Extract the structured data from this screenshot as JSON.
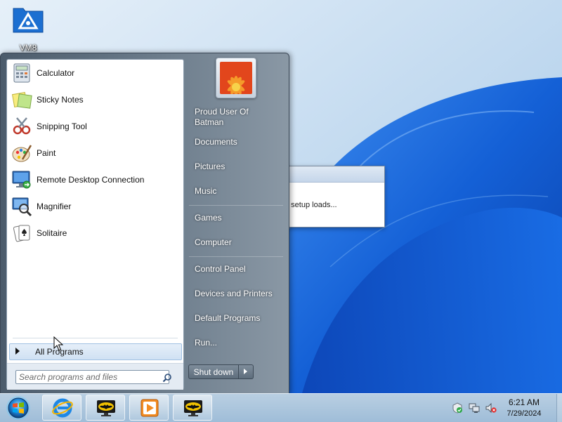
{
  "desktop": {
    "icons": [
      {
        "label": "VM8",
        "icon": "vm8-logo-icon"
      }
    ]
  },
  "dialog": {
    "message": "e setup loads..."
  },
  "start_menu": {
    "pinned": [
      {
        "label": "Calculator",
        "icon": "calculator-icon"
      },
      {
        "label": "Sticky Notes",
        "icon": "sticky-notes-icon"
      },
      {
        "label": "Snipping Tool",
        "icon": "snipping-tool-icon"
      },
      {
        "label": "Paint",
        "icon": "paint-icon"
      },
      {
        "label": "Remote Desktop Connection",
        "icon": "remote-desktop-icon"
      },
      {
        "label": "Magnifier",
        "icon": "magnifier-icon"
      },
      {
        "label": "Solitaire",
        "icon": "solitaire-icon"
      }
    ],
    "all_programs_label": "All Programs",
    "search_placeholder": "Search programs and files",
    "user_name": "Proud User Of Batman",
    "right_items": [
      "Documents",
      "Pictures",
      "Music",
      "Games",
      "Computer",
      "Control Panel",
      "Devices and Printers",
      "Default Programs",
      "Run..."
    ],
    "shutdown_label": "Shut down"
  },
  "taskbar": {
    "buttons": [
      "internet-explorer-icon",
      "batman-app-icon",
      "media-player-icon",
      "batman-app-icon"
    ],
    "tray_icons": [
      "action-center-icon",
      "network-icon",
      "volume-muted-icon"
    ],
    "clock": {
      "time": "6:21 AM",
      "date": "7/29/2024"
    }
  },
  "colors": {
    "wallpaper_blue": "#1565d8",
    "taskbar": "#a9c5de",
    "menu_right": "#6c7c8b"
  }
}
